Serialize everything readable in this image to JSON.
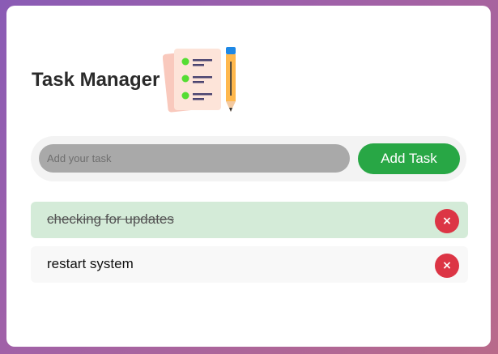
{
  "app": {
    "title": "Task Manager"
  },
  "input": {
    "placeholder": "Add your task",
    "value": ""
  },
  "add_button": {
    "label": "Add Task"
  },
  "tasks": [
    {
      "text": "checking for updates",
      "completed": true,
      "delete_icon": "×"
    },
    {
      "text": "restart system",
      "completed": false,
      "delete_icon": "×"
    }
  ],
  "colors": {
    "accent_green": "#28a745",
    "delete_red": "#dc3545",
    "completed_bg": "#d4ebd8",
    "input_bg": "#a9a9a9"
  },
  "icons": {
    "logo": "checklist-with-pencil-icon"
  }
}
